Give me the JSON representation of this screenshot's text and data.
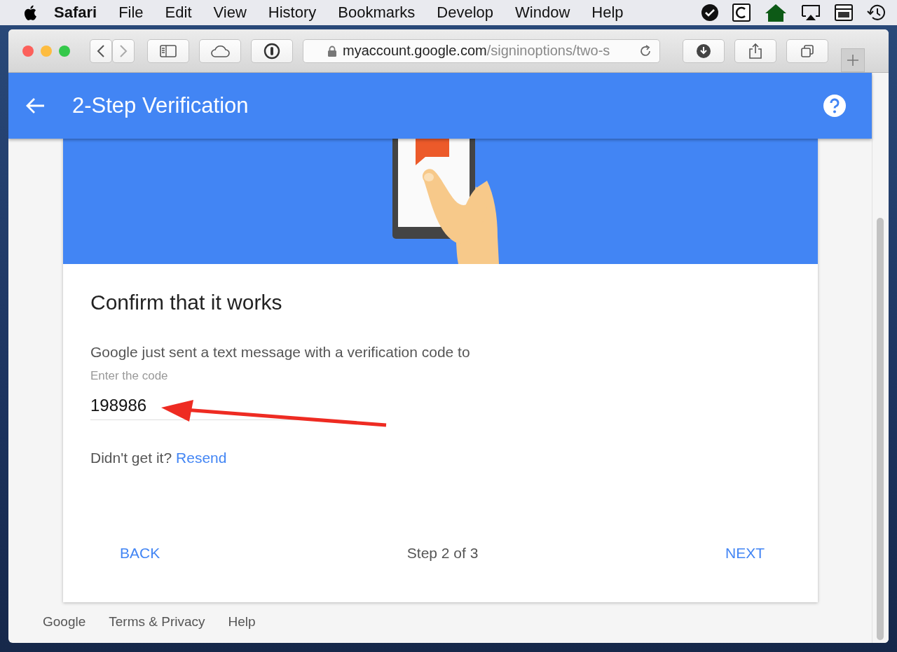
{
  "menu_bar": {
    "app": "Safari",
    "items": [
      "File",
      "Edit",
      "View",
      "History",
      "Bookmarks",
      "Develop",
      "Window",
      "Help"
    ]
  },
  "address_bar": {
    "host": "myaccount.google.com",
    "path": "/signinoptions/two-s"
  },
  "header": {
    "title": "2-Step Verification"
  },
  "card": {
    "title": "Confirm that it works",
    "message": "Google just sent a text message with a verification code to",
    "code_field": {
      "label": "Enter the code",
      "value": "198986"
    },
    "resend_prompt": "Didn't get it?",
    "resend_link": "Resend",
    "back": "BACK",
    "step": "Step 2 of 3",
    "next": "NEXT"
  },
  "footer": [
    "Google",
    "Terms & Privacy",
    "Help"
  ]
}
